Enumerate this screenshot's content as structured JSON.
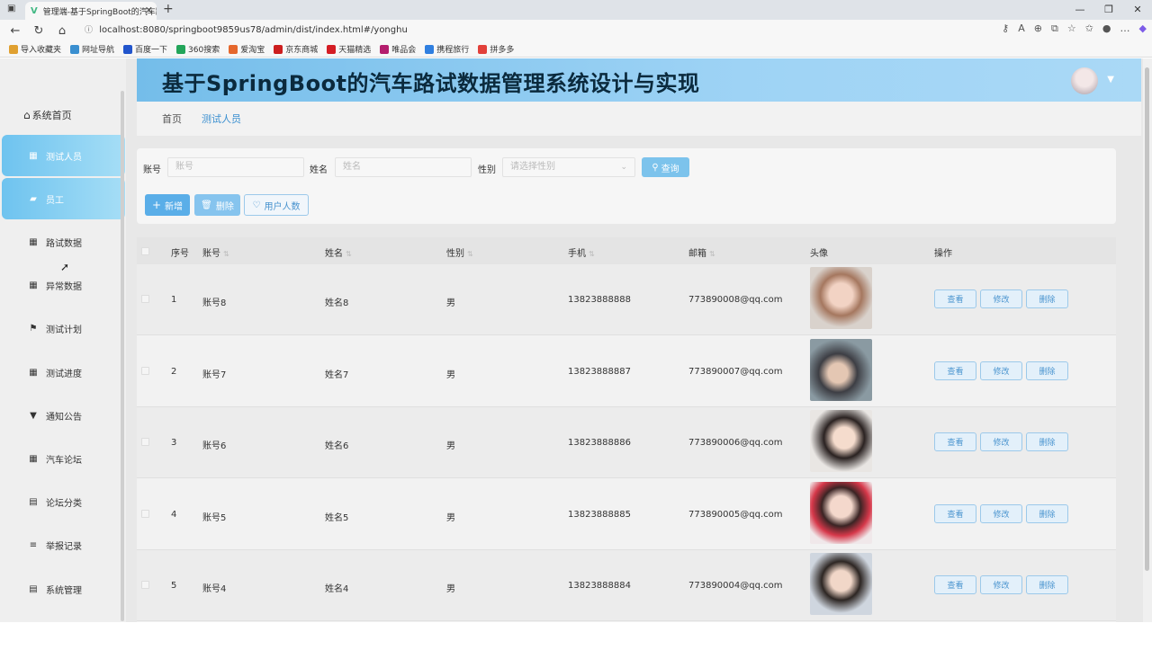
{
  "browser": {
    "tab_title": "管理端-基于SpringBoot的汽车路...",
    "url": "localhost:8080/springboot9859us78/admin/dist/index.html#/yonghu",
    "bookmarks": [
      "导入收藏夹",
      "网址导航",
      "百度一下",
      "360搜索",
      "爱淘宝",
      "京东商城",
      "天猫精选",
      "唯品会",
      "携程旅行",
      "拼多多"
    ]
  },
  "header": {
    "title": "基于SpringBoot的汽车路试数据管理系统设计与实现"
  },
  "sidebar": {
    "home": "系统首页",
    "items": [
      {
        "label": "测试人员",
        "icon": "grid-icon",
        "active": true
      },
      {
        "label": "员工",
        "icon": "briefcase-icon",
        "active": true
      },
      {
        "label": "路试数据",
        "icon": "grid-icon",
        "active": false
      },
      {
        "label": "异常数据",
        "icon": "grid-icon",
        "active": false
      },
      {
        "label": "测试计划",
        "icon": "flag-icon",
        "active": false
      },
      {
        "label": "测试进度",
        "icon": "grid-icon",
        "active": false
      },
      {
        "label": "通知公告",
        "icon": "pin-icon",
        "active": false
      },
      {
        "label": "汽车论坛",
        "icon": "grid-icon",
        "active": false
      },
      {
        "label": "论坛分类",
        "icon": "clipboard-icon",
        "active": false
      },
      {
        "label": "举报记录",
        "icon": "list-icon",
        "active": false
      },
      {
        "label": "系统管理",
        "icon": "clipboard-icon",
        "active": false
      }
    ]
  },
  "breadcrumb": {
    "home": "首页",
    "current": "测试人员"
  },
  "search": {
    "account_label": "账号",
    "account_placeholder": "账号",
    "name_label": "姓名",
    "name_placeholder": "姓名",
    "gender_label": "性别",
    "gender_placeholder": "请选择性别",
    "query_button": "查询"
  },
  "actions": {
    "add": "新增",
    "delete": "删除",
    "user_count": "用户人数"
  },
  "table": {
    "headers": {
      "index": "序号",
      "account": "账号",
      "name": "姓名",
      "gender": "性别",
      "phone": "手机",
      "email": "邮箱",
      "avatar": "头像",
      "ops": "操作"
    },
    "row_buttons": {
      "view": "查看",
      "edit": "修改",
      "delete": "删除"
    },
    "rows": [
      {
        "index": "1",
        "account": "账号8",
        "name": "姓名8",
        "gender": "男",
        "phone": "13823888888",
        "email": "773890008@qq.com"
      },
      {
        "index": "2",
        "account": "账号7",
        "name": "姓名7",
        "gender": "男",
        "phone": "13823888887",
        "email": "773890007@qq.com"
      },
      {
        "index": "3",
        "account": "账号6",
        "name": "姓名6",
        "gender": "男",
        "phone": "13823888886",
        "email": "773890006@qq.com"
      },
      {
        "index": "4",
        "account": "账号5",
        "name": "姓名5",
        "gender": "男",
        "phone": "13823888885",
        "email": "773890005@qq.com"
      },
      {
        "index": "5",
        "account": "账号4",
        "name": "姓名4",
        "gender": "男",
        "phone": "13823888884",
        "email": "773890004@qq.com"
      }
    ]
  },
  "colors": {
    "accent": "#5aaee8",
    "header_gradient_start": "#74bdea",
    "active_menu": "#6ec3ef"
  }
}
